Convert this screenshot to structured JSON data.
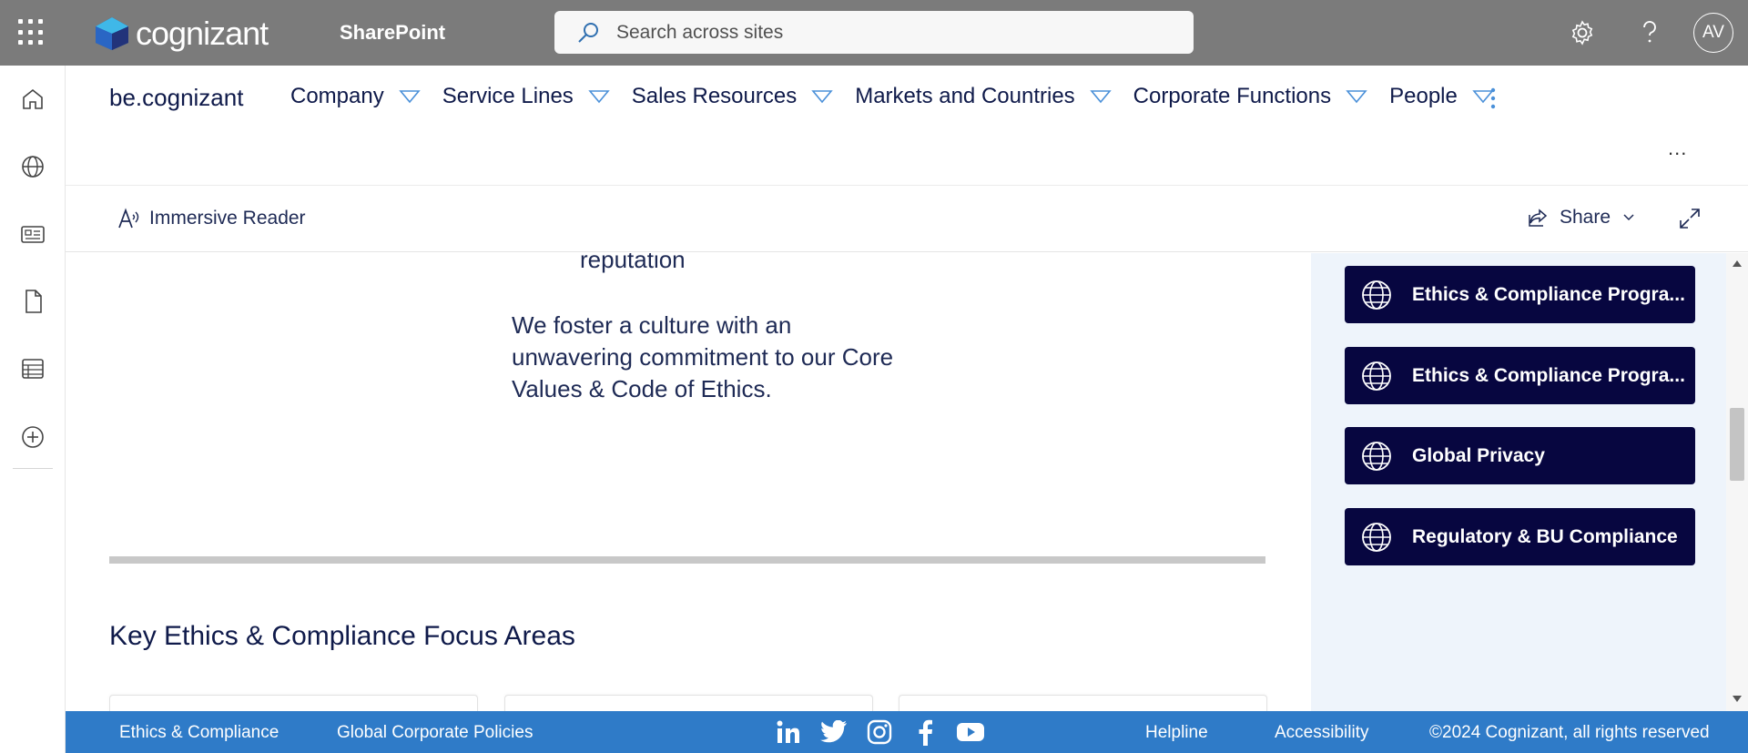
{
  "suite": {
    "brand": "cognizant",
    "app_name": "SharePoint",
    "search_placeholder": "Search across sites",
    "avatar_initials": "AV"
  },
  "site": {
    "title": "be.cognizant",
    "nav": [
      {
        "label": "Company"
      },
      {
        "label": "Service Lines"
      },
      {
        "label": "Sales Resources"
      },
      {
        "label": "Markets and Countries"
      },
      {
        "label": "Corporate Functions"
      },
      {
        "label": "People"
      }
    ],
    "more_label": "..."
  },
  "command_bar": {
    "immersive_reader": "Immersive Reader",
    "share": "Share"
  },
  "content": {
    "reputation_text": "reputation",
    "culture_text": "We foster a culture with an unwavering commitment to our Core Values & Code of Ethics.",
    "section_title": "Key Ethics & Compliance Focus Areas"
  },
  "quick_links": [
    {
      "label": "Ethics & Compliance Progra...",
      "icon": "globe-icon"
    },
    {
      "label": "Ethics & Compliance Progra...",
      "icon": "globe-icon"
    },
    {
      "label": "Global Privacy",
      "icon": "globe-icon"
    },
    {
      "label": "Regulatory & BU Compliance",
      "icon": "globe-icon"
    }
  ],
  "footer": {
    "link1": "Ethics & Compliance",
    "link2": "Global Corporate Policies",
    "helpline": "Helpline",
    "accessibility": "Accessibility",
    "copyright": "©2024 Cognizant, all rights reserved",
    "social": [
      "linkedin-icon",
      "twitter-icon",
      "instagram-icon",
      "facebook-icon",
      "youtube-icon"
    ]
  },
  "colors": {
    "suitebar": "#7b7b7b",
    "quick_link_bg": "#070640",
    "footer_bg": "#2f7bc8",
    "nav_text": "#0f1a4a"
  }
}
